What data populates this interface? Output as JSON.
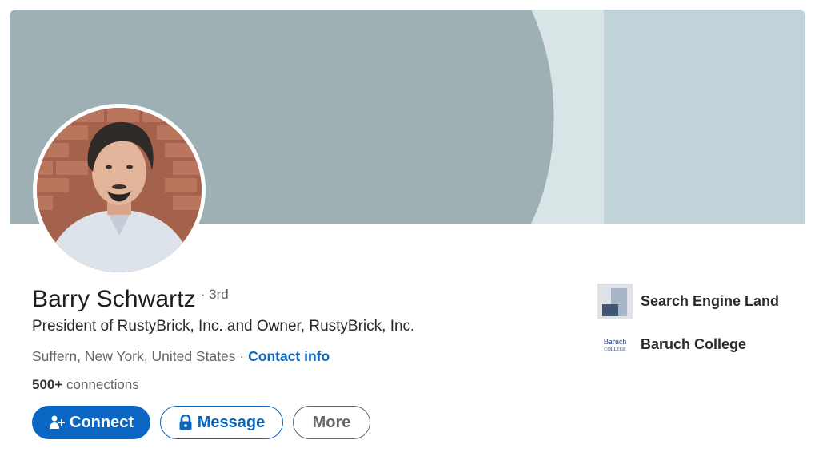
{
  "profile": {
    "name": "Barry Schwartz",
    "degree": "· 3rd",
    "headline": "President of RustyBrick, Inc. and Owner, RustyBrick, Inc.",
    "location": "Suffern, New York, United States",
    "separator": "·",
    "contact_info": "Contact info",
    "connections_count": "500+",
    "connections_label": "connections"
  },
  "actions": {
    "connect": "Connect",
    "message": "Message",
    "more": "More"
  },
  "side": {
    "items": [
      {
        "label": "Search Engine Land",
        "icon": "search-engine-land-logo"
      },
      {
        "label": "Baruch College",
        "icon": "baruch-college-logo",
        "logo_text_top": "Baruch",
        "logo_text_bottom": "COLLEGE"
      }
    ]
  },
  "colors": {
    "brand_blue": "#0a66c2",
    "banner_dark": "#9eb0b4",
    "banner_light": "#c0d3d8",
    "banner_mid": "#d9e4e7"
  }
}
